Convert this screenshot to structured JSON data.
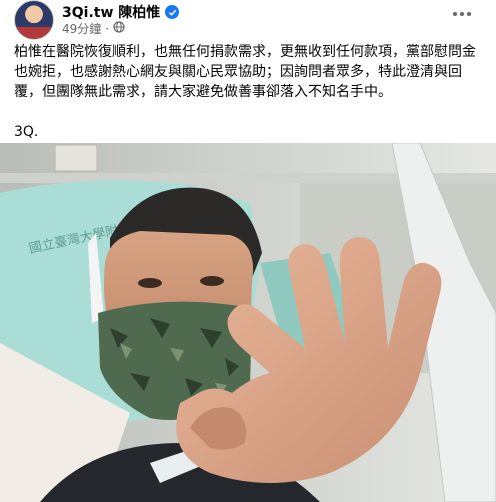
{
  "post": {
    "author": "3Qi.tw 陳柏惟",
    "time": "49分鐘",
    "separator": "·",
    "audience_icon": "globe-icon",
    "verified_icon": "verified-badge-icon",
    "more_icon": "more-options-icon",
    "text_paragraph": "柏惟在醫院恢復順利，也無任何捐款需求，更無收到任何款項，黨部慰問金也婉拒，也感謝熱心網友與關心民眾協助；因詢問者眾多，特此澄清與回覆，但團隊無此需求，請大家避免做善事卻落入不知名手中。",
    "text_signoff": "3Q.",
    "photo_caption_text": "國立臺灣大學附設醫院"
  },
  "colors": {
    "accent": "#1877f2",
    "secondary_text": "#65676b",
    "primary_text": "#050505"
  }
}
